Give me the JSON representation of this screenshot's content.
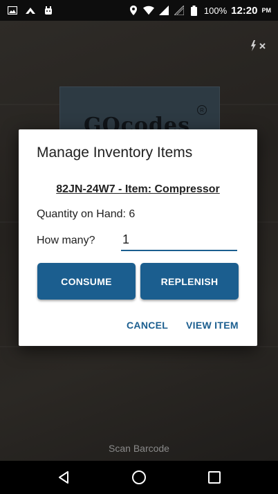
{
  "status_bar": {
    "icons_left": [
      "image-icon",
      "cloud-icon",
      "android-icon"
    ],
    "icons_right": [
      "location-icon",
      "wifi-icon",
      "signal-icon",
      "no-signal-icon",
      "battery-icon"
    ],
    "battery_percent": "100%",
    "time": "12:20",
    "ampm": "PM"
  },
  "camera": {
    "logo_text": "GOcodes",
    "flash_icon": "flash-off-icon",
    "scan_label": "Scan Barcode"
  },
  "dialog": {
    "title": "Manage Inventory Items",
    "item_name": "82JN-24W7 - Item: Compressor",
    "quantity_label": "Quantity on Hand: 6",
    "how_many_label": "How many?",
    "how_many_value": "1",
    "consume_label": "CONSUME",
    "replenish_label": "REPLENISH",
    "cancel_label": "CANCEL",
    "view_item_label": "VIEW ITEM"
  },
  "nav_bar": {
    "buttons": [
      "back-icon",
      "home-icon",
      "recents-icon"
    ]
  },
  "colors": {
    "accent": "#1b5e8f",
    "dialog_bg": "#ffffff",
    "status_bar_bg": "#0d0d0d"
  }
}
